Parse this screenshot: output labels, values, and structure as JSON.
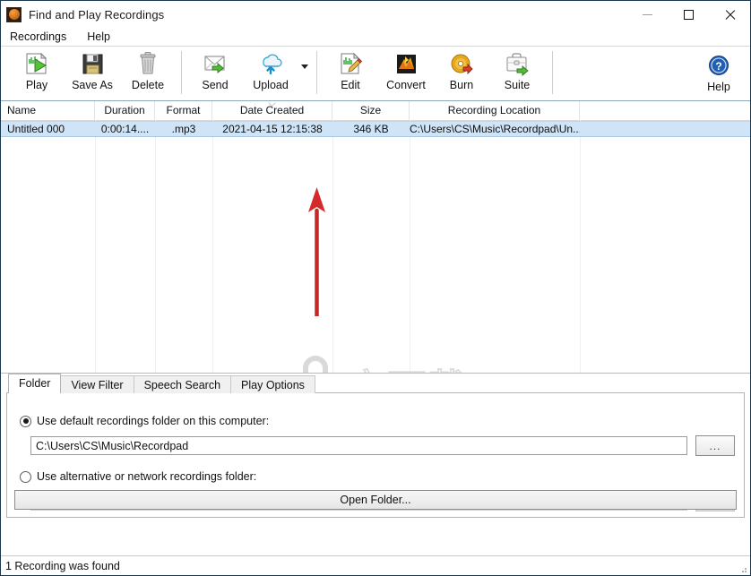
{
  "window": {
    "title": "Find and Play Recordings",
    "icon": "app-recordpad-icon",
    "controls": {
      "minimize": "Minimize",
      "maximize": "Maximize",
      "close": "Close"
    }
  },
  "menubar": {
    "items": [
      {
        "label": "Recordings"
      },
      {
        "label": "Help"
      }
    ]
  },
  "toolbar": {
    "groups": [
      {
        "buttons": [
          {
            "label": "Play",
            "icon": "play-waveform-icon"
          },
          {
            "label": "Save As",
            "icon": "floppy-disk-icon"
          },
          {
            "label": "Delete",
            "icon": "trash-can-icon"
          }
        ]
      },
      {
        "buttons": [
          {
            "label": "Send",
            "icon": "envelope-send-icon"
          },
          {
            "label": "Upload",
            "icon": "cloud-upload-icon",
            "has_dropdown": true
          }
        ]
      },
      {
        "buttons": [
          {
            "label": "Edit",
            "icon": "edit-pencil-waveform-icon"
          },
          {
            "label": "Convert",
            "icon": "convert-icon"
          },
          {
            "label": "Burn",
            "icon": "burn-disc-icon"
          },
          {
            "label": "Suite",
            "icon": "suite-briefcase-icon"
          }
        ]
      }
    ],
    "help": {
      "label": "Help",
      "icon": "help-question-icon"
    }
  },
  "listview": {
    "columns": [
      {
        "label": "Name",
        "align": "left",
        "width": 105
      },
      {
        "label": "Duration",
        "align": "center",
        "width": 67
      },
      {
        "label": "Format",
        "align": "center",
        "width": 64
      },
      {
        "label": "Date Created",
        "align": "center",
        "width": 134,
        "sorted": "descending"
      },
      {
        "label": "Size",
        "align": "center",
        "width": 86
      },
      {
        "label": "Recording Location",
        "align": "center",
        "width": 190
      }
    ],
    "rows": [
      {
        "selected": true,
        "name": "Untitled 000",
        "duration": "0:00:14....",
        "format": ".mp3",
        "date_created": "2021-04-15 12:15:38",
        "size": "346 KB",
        "location": "C:\\Users\\CS\\Music\\Recordpad\\Un..."
      }
    ]
  },
  "watermark": {
    "text_cn": "安下载",
    "text_domain": "anxz.com",
    "shield_char": "安"
  },
  "annotation": {
    "type": "red-arrow",
    "color": "#d32b2b",
    "points_to": "Upload dropdown / Edit toolbar area"
  },
  "bottom": {
    "tabs": [
      {
        "label": "Folder",
        "active": true
      },
      {
        "label": "View Filter",
        "active": false
      },
      {
        "label": "Speech Search",
        "active": false
      },
      {
        "label": "Play Options",
        "active": false
      }
    ],
    "folder_panel": {
      "default_option": {
        "label": "Use default recordings folder on this computer:",
        "selected": true,
        "path_value": "C:\\Users\\CS\\Music\\Recordpad",
        "browse_label": "..."
      },
      "alternative_option": {
        "label": "Use alternative or network recordings folder:",
        "selected": false,
        "path_value": "",
        "path_placeholder": "",
        "browse_label": "..."
      },
      "open_folder_label": "Open Folder..."
    }
  },
  "statusbar": {
    "text": "1 Recording was found"
  }
}
